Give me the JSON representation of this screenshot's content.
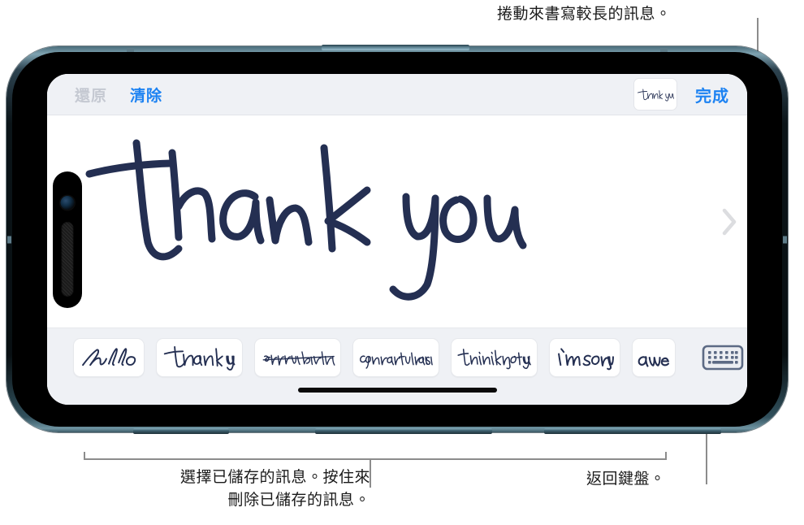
{
  "callouts": {
    "top_right": "捲動來書寫較長的訊息。",
    "bottom_left": "選擇已儲存的訊息。按住來\n刪除已儲存的訊息。",
    "bottom_right": "返回鍵盤。"
  },
  "device": {
    "name": "iphone-landscape",
    "orientation": "landscape"
  },
  "toolbar": {
    "undo_label": "還原",
    "undo_enabled": false,
    "clear_label": "清除",
    "done_label": "完成",
    "saved_thumbnail_text": "thank you",
    "accent_color": "#1c82f2",
    "disabled_color": "#c5c9d2",
    "background_color": "#eff1f5"
  },
  "canvas": {
    "handwriting_text": "thank you",
    "ink_color": "#242f52",
    "scroll_icon": "chevron-right-icon"
  },
  "suggestions": {
    "items": [
      {
        "text": "hello"
      },
      {
        "text": "thank you"
      },
      {
        "text": "happy birthday."
      },
      {
        "text": "congratulations"
      },
      {
        "text": "thinking of you"
      },
      {
        "text": "I'm sorry"
      },
      {
        "text": "awe"
      }
    ],
    "keyboard_icon": "keyboard-icon",
    "background_color": "#eff1f5"
  },
  "leader_line_color": "#8c8c8c"
}
